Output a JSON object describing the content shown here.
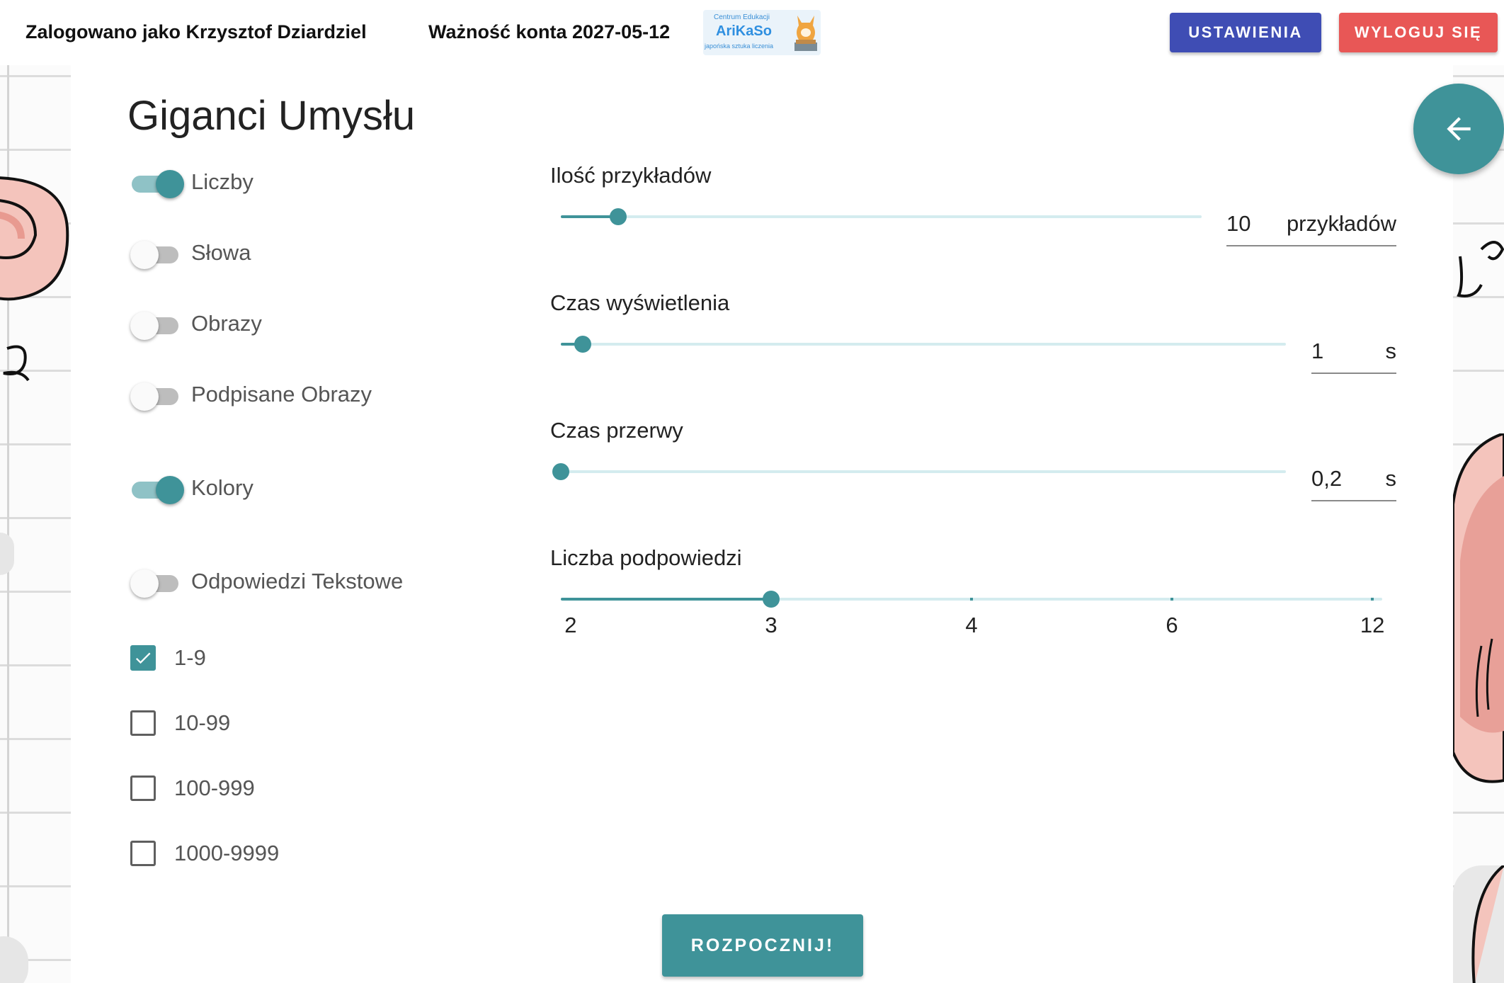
{
  "header": {
    "user_text": "Zalogowano jako Krzysztof Dziardziel",
    "validity_text": "Ważność konta 2027-05-12",
    "logo": {
      "line1": "Centrum Edukacji",
      "line2": "AriKaSo",
      "line3": "japońska sztuka liczenia"
    },
    "settings_label": "USTAWIENIA",
    "logout_label": "WYLOGUJ SIĘ"
  },
  "main": {
    "title": "Giganci Umysłu",
    "toggles": [
      {
        "label": "Liczby",
        "on": true
      },
      {
        "label": "Słowa",
        "on": false
      },
      {
        "label": "Obrazy",
        "on": false
      },
      {
        "label": "Podpisane Obrazy",
        "on": false
      },
      {
        "label": "Kolory",
        "on": true
      },
      {
        "label": "Odpowiedzi Tekstowe",
        "on": false
      }
    ],
    "ranges": [
      {
        "label": "1-9",
        "checked": true
      },
      {
        "label": "10-99",
        "checked": false
      },
      {
        "label": "100-999",
        "checked": false
      },
      {
        "label": "1000-9999",
        "checked": false
      }
    ],
    "sliders": {
      "examples": {
        "label": "Ilość przykładów",
        "value": "10",
        "unit": "przykładów",
        "fraction": 0.09
      },
      "display_time": {
        "label": "Czas wyświetlenia",
        "value": "1",
        "unit": "s",
        "fraction": 0.03
      },
      "break_time": {
        "label": "Czas przerwy",
        "value": "0,2",
        "unit": "s",
        "fraction": 0.0
      },
      "hints": {
        "label": "Liczba podpowiedzi",
        "marks": [
          "2",
          "3",
          "4",
          "6",
          "12"
        ],
        "selected_index": 1
      }
    },
    "start_label": "ROZPOCZNIJ!"
  },
  "icons": {
    "back": "arrow-left-icon",
    "check": "check-icon",
    "mascot": "fox-icon"
  },
  "colors": {
    "primary": "#3f9399",
    "settings": "#3f4db4",
    "logout": "#e85756"
  }
}
